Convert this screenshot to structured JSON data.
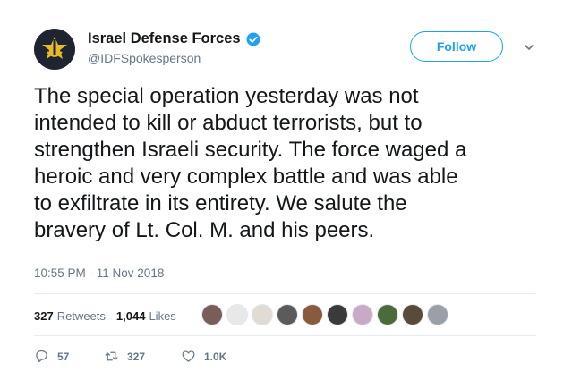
{
  "author": {
    "display_name": "Israel Defense Forces",
    "handle": "@IDFSpokesperson",
    "verified_icon": "verified-badge-icon",
    "avatar_icon": "idf-emblem-icon"
  },
  "header": {
    "follow_label": "Follow",
    "menu_icon": "chevron-down-icon"
  },
  "tweet": {
    "lines": [
      "The special operation yesterday was not",
      "intended to kill or abduct terrorists, but to",
      "strengthen Israeli security. The force waged a",
      "heroic and very complex battle and was able",
      "to exfiltrate in its entirety. We salute the",
      "bravery of Lt. Col. M. and his peers."
    ],
    "timestamp": "10:55 PM - 11 Nov 2018"
  },
  "stats": {
    "retweets_count": "327",
    "retweets_label": "Retweets",
    "likes_count": "1,044",
    "likes_label": "Likes"
  },
  "likers": {
    "avatar_colors": [
      "#7a5c58",
      "#e8e8e8",
      "#e0dcd4",
      "#5b5b5b",
      "#8a5a3c",
      "#3a3a3a",
      "#c9a9c8",
      "#4a6b3a",
      "#5a4a3a",
      "#9aa0a8"
    ]
  },
  "actions": {
    "reply_count": "57",
    "retweet_count": "327",
    "like_count": "1.0K"
  },
  "colors": {
    "accent": "#1da1f2",
    "text": "#14171a",
    "secondary": "#657786"
  }
}
